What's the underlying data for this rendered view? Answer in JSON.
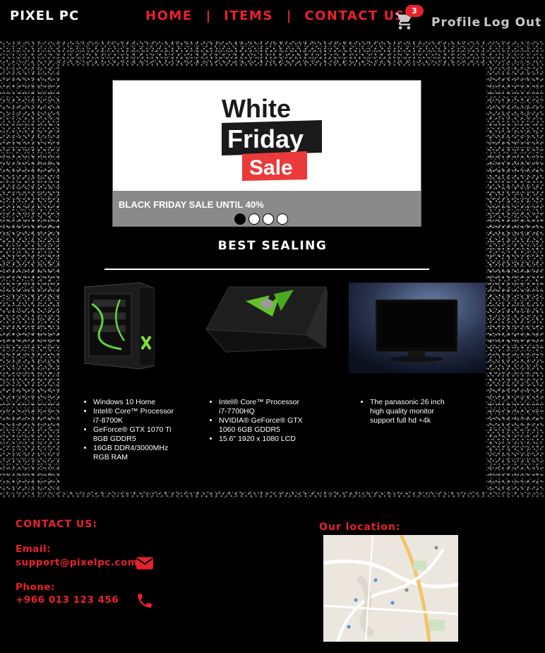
{
  "header": {
    "brand": "PIXEL PC",
    "nav": [
      "HOME",
      "ITEMS",
      "CONTACT US"
    ],
    "separator": "|",
    "cart_count": "3",
    "profile": "Profile",
    "logout": "Log Out"
  },
  "slider": {
    "image_text": [
      "White",
      "Friday",
      "Sale"
    ],
    "caption": "BLACK FRIDAY SALE UNTIL 40%",
    "active_slide": 1,
    "slide_count": 4
  },
  "products": {
    "title": "BEST SEALING",
    "items": [
      {
        "image": "desktop-pc",
        "specs": [
          "Windows 10 Home",
          "Intel® Core™ Processor i7-8700K",
          "GeForce® GTX 1070 Ti 8GB GDDR5",
          "16GB DDR4/3000MHz RGB RAM"
        ]
      },
      {
        "image": "gaming-laptop",
        "specs": [
          "Intel® Core™ Processor i7-7700HQ",
          "NVIDIA® GeForce® GTX 1060 6GB GDDR5",
          "15.6\" 1920 x 1080 LCD"
        ]
      },
      {
        "image": "monitor",
        "specs": [
          "The panasonic 26 inch high quality monitor support full hd +4k"
        ]
      }
    ]
  },
  "footer": {
    "contact_heading": "CONTACT US:",
    "email_label": "Email:",
    "email": "support@pixelpc.com",
    "phone_label": "Phone:",
    "phone": "+966 013 123 456",
    "location_heading": "Our location:"
  },
  "colors": {
    "accent": "#e8222c",
    "background": "#000000",
    "muted_link": "#c9c9c9"
  }
}
